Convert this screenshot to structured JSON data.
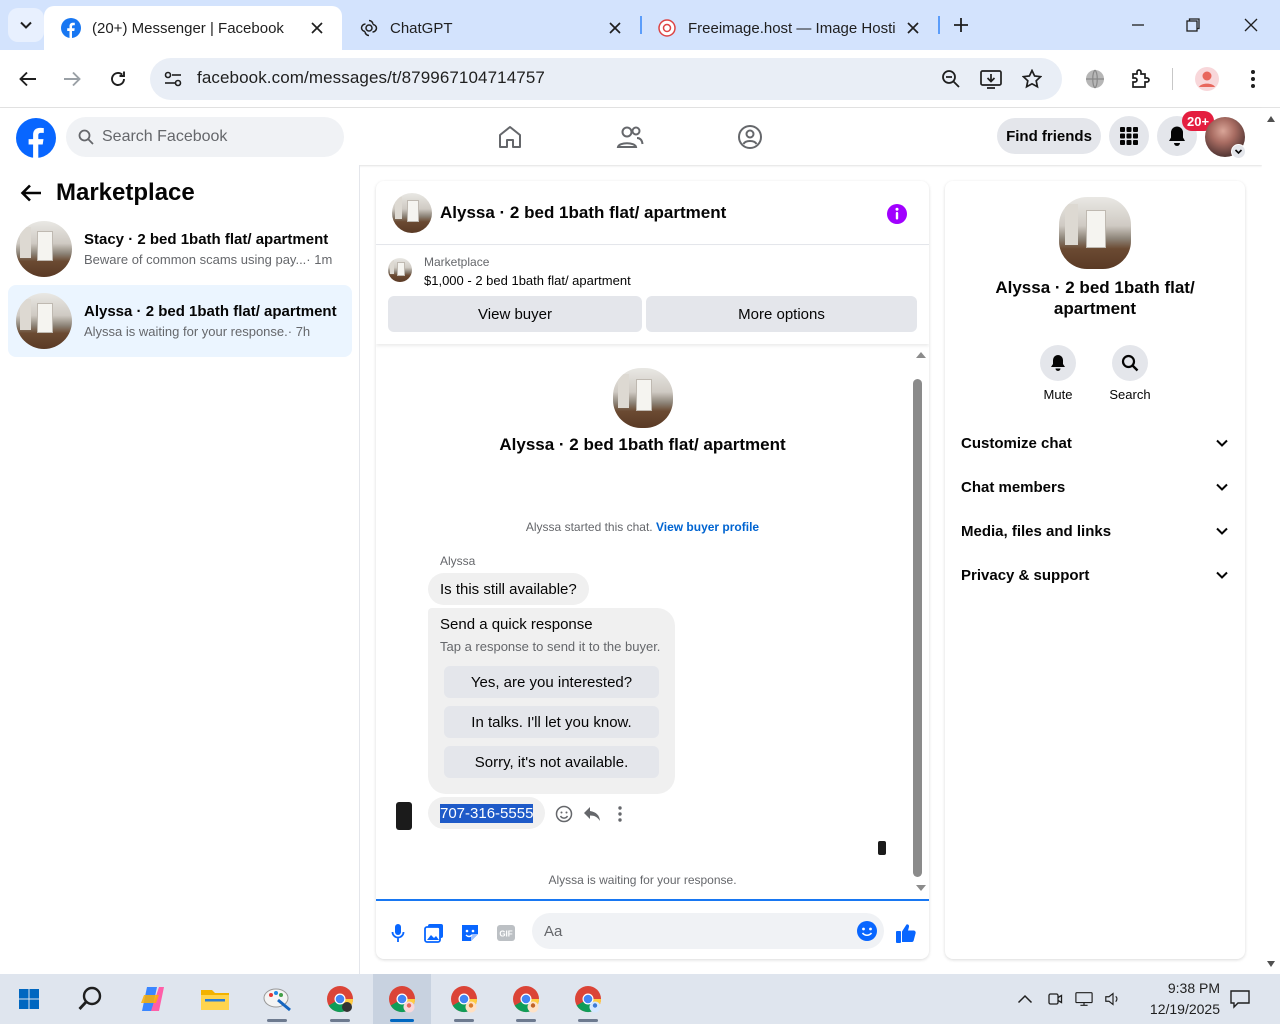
{
  "browser": {
    "tabs": [
      {
        "label": "(20+) Messenger | Facebook",
        "icon": "facebook-icon",
        "active": true
      },
      {
        "label": "ChatGPT",
        "icon": "chatgpt-icon",
        "active": false
      },
      {
        "label": "Freeimage.host — Image Hostin",
        "icon": "freeimage-icon",
        "active": false
      }
    ],
    "url": "facebook.com/messages/t/879967104714757"
  },
  "fb": {
    "search_placeholder": "Search Facebook",
    "find_friends": "Find friends",
    "notification_badge": "20+",
    "brand_color": "#1877f2"
  },
  "sidebar": {
    "title": "Marketplace",
    "conversations": [
      {
        "name": "Stacy · 2 bed 1bath flat/ apartment",
        "snippet": "Beware of common scams using pay...",
        "time": " · 1m",
        "active": false
      },
      {
        "name": "Alyssa · 2 bed 1bath flat/ apartment",
        "snippet": "Alyssa is waiting for your response.",
        "time": " · 7h",
        "active": true
      }
    ]
  },
  "chat": {
    "title": "Alyssa · 2 bed 1bath flat/ apartment",
    "listing": {
      "label": "Marketplace",
      "price_title": "$1,000 - 2 bed 1bath flat/ apartment",
      "view_buyer": "View buyer",
      "more_options": "More options"
    },
    "intro_name": "Alyssa · 2 bed 1bath flat/ apartment",
    "started_text": "Alyssa started this chat. ",
    "view_buyer_profile": "View buyer profile",
    "sender": "Alyssa",
    "message1": "Is this still available?",
    "quick_response": {
      "title": "Send a quick response",
      "subtitle": "Tap a response to send it to the buyer.",
      "options": [
        "Yes, are you interested?",
        "In talks. I'll let you know.",
        "Sorry, it's not available."
      ]
    },
    "phone_message": "707-316-5555",
    "waiting_text": "Alyssa is waiting for your response.",
    "composer_placeholder": "Aa"
  },
  "info": {
    "name": "Alyssa · 2 bed 1bath flat/ apartment",
    "mute": "Mute",
    "search": "Search",
    "sections": [
      "Customize chat",
      "Chat members",
      "Media, files and links",
      "Privacy & support"
    ]
  },
  "taskbar": {
    "time": "9:38 PM",
    "date": "12/19/2025"
  }
}
